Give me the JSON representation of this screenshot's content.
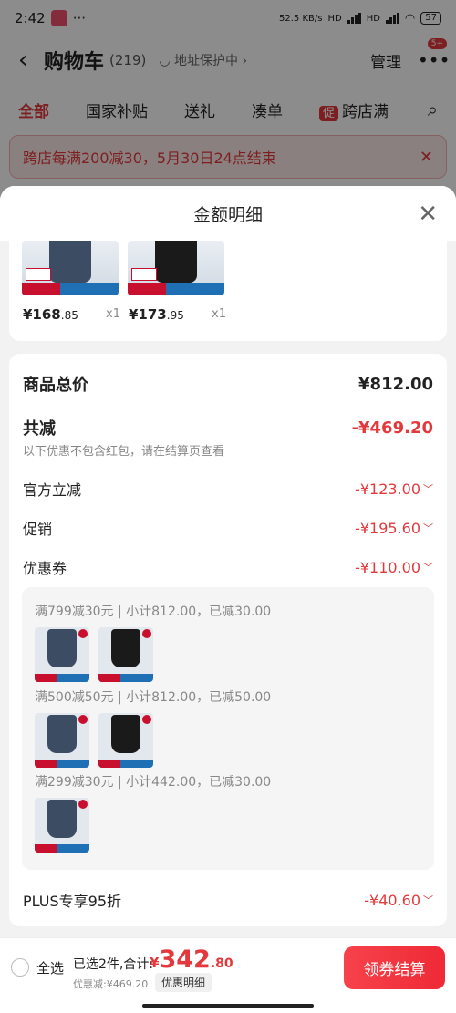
{
  "status_bar": {
    "time": "2:42",
    "dots": "···",
    "net_speed": "52.5 KB/s",
    "hd1": "HD",
    "hd2": "HD",
    "battery": "57"
  },
  "cart_header": {
    "title": "购物车",
    "count": "(219)",
    "address_protect": "地址保护中",
    "manage": "管理",
    "more_badge": "5+"
  },
  "tabs": [
    {
      "label": "全部",
      "active": true
    },
    {
      "label": "国家补贴"
    },
    {
      "label": "送礼"
    },
    {
      "label": "凑单"
    },
    {
      "label": "跨店满",
      "promo_tag": "促"
    }
  ],
  "notice": {
    "text": "跨店每满200减30，5月30日24点结束"
  },
  "sheet": {
    "title": "金额明细",
    "items": [
      {
        "price_int": "¥168",
        "price_dec": ".85",
        "qty": "x1",
        "thumb_price": "265"
      },
      {
        "price_int": "¥173",
        "price_dec": ".95",
        "qty": "x1",
        "thumb_price": "229"
      }
    ],
    "detail": {
      "total_label": "商品总价",
      "total_value": "¥812.00",
      "reduce_label": "共减",
      "reduce_value": "-¥469.20",
      "hint": "以下优惠不包含红包，请在结算页查看",
      "official_label": "官方立减",
      "official_value": "-¥123.00",
      "promo_label": "促销",
      "promo_value": "-¥195.60",
      "coupon_label": "优惠券",
      "coupon_value": "-¥110.00",
      "coupon_lines": [
        "满799减30元 | 小计812.00，已减30.00",
        "满500减50元 | 小计812.00，已减50.00",
        "满299减30元 | 小计442.00，已减30.00"
      ],
      "plus_label": "PLUS专享95折",
      "plus_value": "-¥40.60"
    }
  },
  "bottom_bar": {
    "select_all": "全选",
    "selected_text": "已选2件,合计:",
    "total_currency": "¥",
    "total_int": "342",
    "total_dec": ".80",
    "discount_text": "优惠减:¥469.20",
    "detail_pill": "优惠明细",
    "checkout": "领券结算"
  },
  "colors": {
    "accent": "#e4393c",
    "checkout": "#f0303a"
  }
}
